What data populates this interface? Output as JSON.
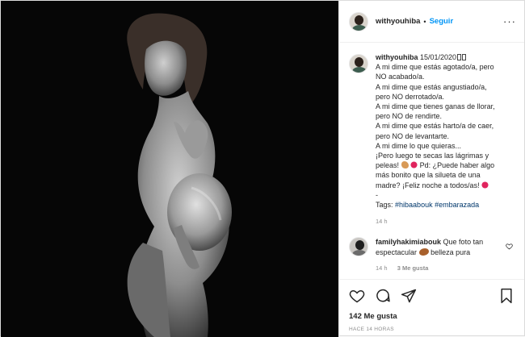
{
  "header": {
    "username": "withyouhiba",
    "separator": "•",
    "follow_label": "Seguir",
    "more_icon": "more-options-icon"
  },
  "caption": {
    "username": "withyouhiba",
    "date": "15/01/2020",
    "lines": [
      "A mi dime que estás agotado/a, pero",
      "NO acabado/a.",
      "A mi dime que estás angustiado/a,",
      "pero NO derrotado/a.",
      "A mi dime que tienes ganas de llorar,",
      "pero NO de rendirte.",
      "A mi dime que estás harto/a de caer,",
      "pero NO de levantarte.",
      "A mi dime lo que quieras...",
      "¡Pero luego te secas las lágrimas y",
      "peleas!",
      "Pd: ¿Puede haber algo",
      "más bonito que la silueta de una",
      "madre? ¡Feliz noche a todos/as!",
      "-",
      "Tags:"
    ],
    "tags": [
      "#hibaabouk",
      "#embarazada"
    ],
    "time": "14 h"
  },
  "comment": {
    "username": "familyhakimiabouk",
    "text_a": "Que foto tan",
    "text_b": "espectacular",
    "text_c": "belleza pura",
    "time": "14 h",
    "likes": "3 Me gusta"
  },
  "actions": {
    "like_icon": "heart-icon",
    "comment_icon": "comment-icon",
    "share_icon": "share-icon",
    "save_icon": "bookmark-icon"
  },
  "likes": "142 Me gusta",
  "ago": "HACE 14 HORAS"
}
